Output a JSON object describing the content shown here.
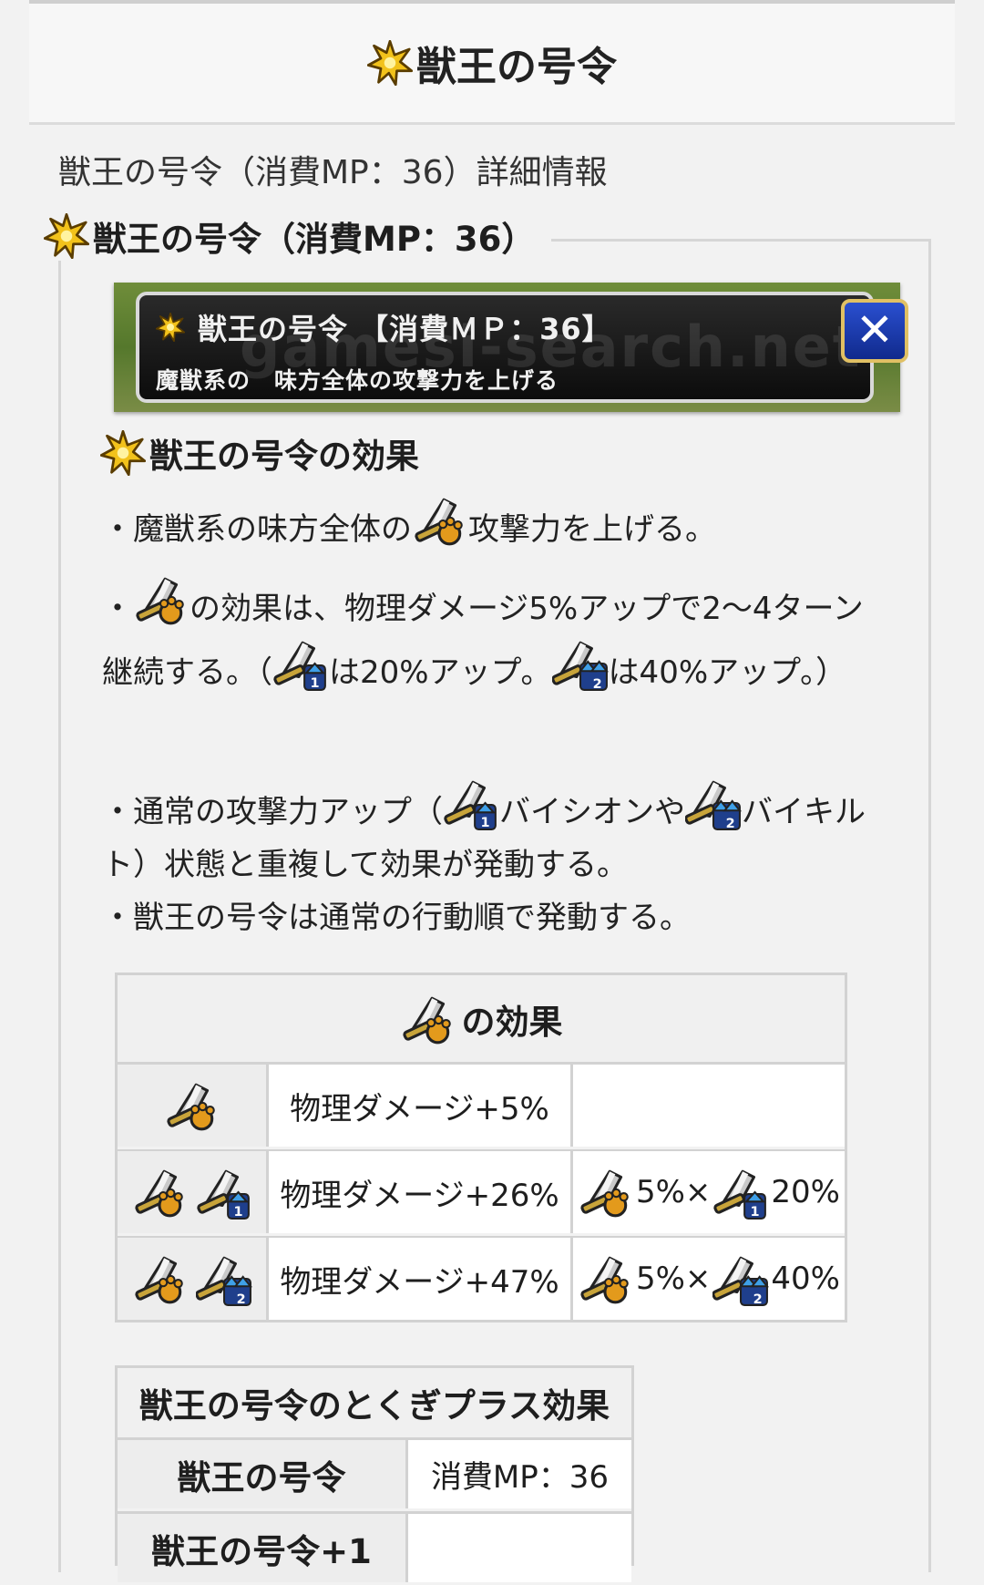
{
  "header": {
    "title": "獣王の号令"
  },
  "subtitle": "獣王の号令（消費MP：36）詳細情報",
  "section": {
    "heading": "獣王の号令（消費MP：36）"
  },
  "game_dialog": {
    "title": "獣王の号令 【消費ＭＰ：36】",
    "description": "魔獣系の　味方全体の攻撃力を上げる",
    "watermark": "gamesi-search.net",
    "close_symbol": "✕"
  },
  "effects": {
    "heading": "獣王の号令の効果",
    "bullet1": {
      "before": "・魔獣系の味方全体の",
      "after": "攻撃力を上げる。"
    },
    "bullet2": {
      "prefix": "・",
      "text1": "の効果は、物理ダメージ5%アップで2〜4ターン継続する。（",
      "text2": "は20%アップ。",
      "text3": "は40%アップ。）"
    },
    "bullet3": {
      "text1": "・通常の攻撃力アップ（",
      "text2": "バイシオンや",
      "text3": "バイキルト）状態と重複して効果が発動する。"
    },
    "bullet4": "・獣王の号令は通常の行動順で発動する。"
  },
  "effect_table": {
    "caption": "の効果",
    "rows": [
      {
        "damage": "物理ダメージ+5%",
        "calc": ""
      },
      {
        "damage": "物理ダメージ+26%",
        "calc_a": "5%×",
        "calc_b": "20%"
      },
      {
        "damage": "物理ダメージ+47%",
        "calc_a": "5%×",
        "calc_b": "40%"
      }
    ]
  },
  "plus_table": {
    "caption": "獣王の号令のとくぎプラス効果",
    "rows": [
      {
        "key": "獣王の号令",
        "value": "消費MP：36"
      },
      {
        "key": "獣王の号令+1",
        "value": ""
      }
    ]
  },
  "colors": {
    "star": "#f2c21b",
    "paw": "#e39a1c",
    "sword": "#b8b8b8",
    "badge_blue": "#1f3f8c"
  }
}
